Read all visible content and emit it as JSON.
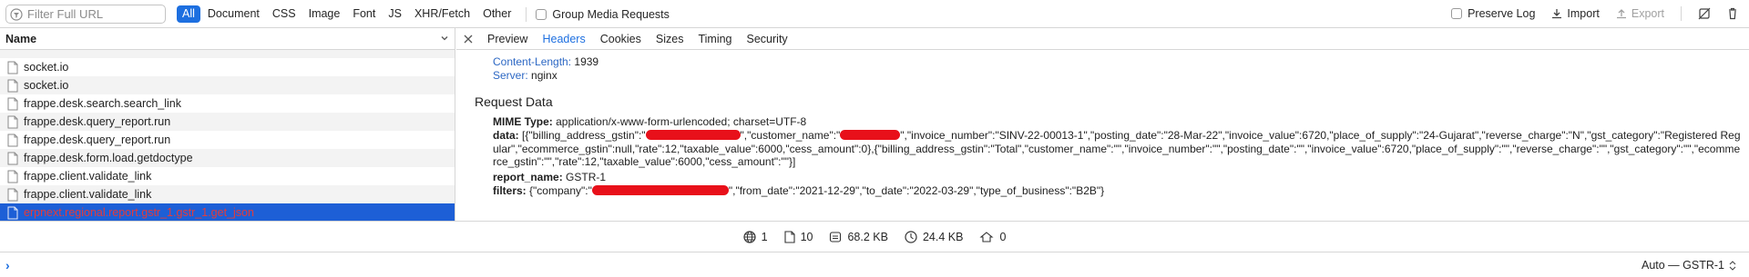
{
  "filter": {
    "placeholder": "Filter Full URL",
    "types": [
      {
        "label": "All",
        "active": true
      },
      {
        "label": "Document"
      },
      {
        "label": "CSS"
      },
      {
        "label": "Image"
      },
      {
        "label": "Font"
      },
      {
        "label": "JS"
      },
      {
        "label": "XHR/Fetch"
      },
      {
        "label": "Other"
      }
    ],
    "group_media": "Group Media Requests",
    "preserve_log": "Preserve Log",
    "import": "Import",
    "export": "Export"
  },
  "list": {
    "header": "Name",
    "items": [
      {
        "label": "socket.io"
      },
      {
        "label": "socket.io"
      },
      {
        "label": "frappe.desk.search.search_link"
      },
      {
        "label": "frappe.desk.query_report.run"
      },
      {
        "label": "frappe.desk.query_report.run"
      },
      {
        "label": "frappe.desk.form.load.getdoctype"
      },
      {
        "label": "frappe.client.validate_link"
      },
      {
        "label": "frappe.client.validate_link"
      },
      {
        "label": "erpnext.regional.report.gstr_1.gstr_1.get_json"
      }
    ]
  },
  "detail": {
    "tabs": [
      "Preview",
      "Headers",
      "Cookies",
      "Sizes",
      "Timing",
      "Security"
    ],
    "active_tab": "Headers",
    "headers": [
      {
        "key": "Content-Length:",
        "value": "1939"
      },
      {
        "key": "Server:",
        "value": "nginx"
      }
    ],
    "request_data_title": "Request Data",
    "mime_key": "MIME Type:",
    "mime_value": "application/x-www-form-urlencoded; charset=UTF-8",
    "data_key": "data:",
    "data_parts": {
      "p1": "[{\"billing_address_gstin\":\"",
      "p2": "\",\"customer_name\":\"",
      "p3": "\",\"invoice_number\":\"SINV-22-00013-1\",\"posting_date\":\"28-Mar-22\",\"invoice_value\":6720,\"place_of_supply\":\"24-Gujarat\",\"reverse_charge\":\"N\",\"gst_category\":\"Registered Regular\",\"ecommerce_gstin\":null,\"rate\":12,\"taxable_value\":6000,\"cess_amount\":0},{\"billing_address_gstin\":\"Total\",\"customer_name\":\"\",\"invoice_number\":\"\",\"posting_date\":\"\",\"invoice_value\":6720,\"place_of_supply\":\"\",\"reverse_charge\":\"\",\"gst_category\":\"\",\"ecommerce_gstin\":\"\",\"rate\":12,\"taxable_value\":6000,\"cess_amount\":\"\"}]"
    },
    "report_key": "report_name:",
    "report_value": "GSTR-1",
    "filters_key": "filters:",
    "filters_parts": {
      "p1": "{\"company\":\"",
      "p2": "\",\"from_date\":\"2021-12-29\",\"to_date\":\"2022-03-29\",\"type_of_business\":\"B2B\"}"
    }
  },
  "summary": {
    "domains": "1",
    "resources": "10",
    "transferred_size": "68.2 KB",
    "resource_size": "24.4 KB",
    "errors": "0"
  },
  "console": {
    "prompt": "›",
    "context": "Auto — GSTR-1"
  },
  "colors": {
    "accent": "#1d6fe0",
    "selected_row": "#1d5fd6",
    "redaction": "#e8101a",
    "header_key": "#2d68c4"
  }
}
